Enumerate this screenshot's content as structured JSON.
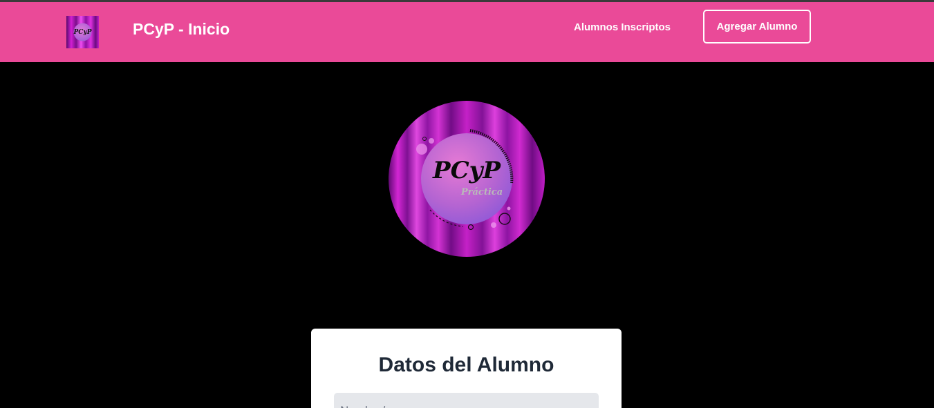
{
  "header": {
    "brand_title": "PCyP - Inicio",
    "nav_link": "Alumnos Inscriptos",
    "nav_button": "Agregar Alumno",
    "logo_text": "PCyP",
    "background_color": "#ea4a98"
  },
  "hero": {
    "logo_title": "PCyP",
    "logo_subtitle": "Práctica"
  },
  "form": {
    "title": "Datos del Alumno",
    "name_placeholder": "Nombre/es"
  }
}
